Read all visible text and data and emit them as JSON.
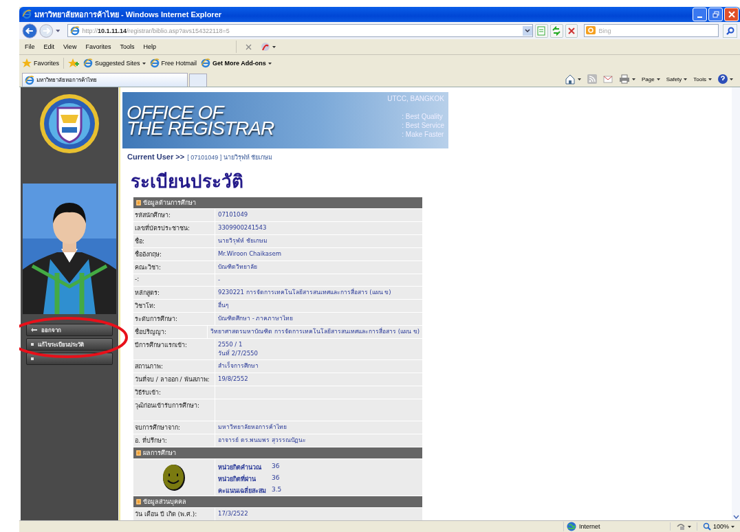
{
  "window": {
    "title": "มหาวิทยาลัยหอการค้าไทย - Windows Internet Explorer"
  },
  "address_bar": {
    "url": "http://**10.1.11.14**/registrar/biblio.asp?avs154322118=5"
  },
  "search": {
    "placeholder": "Bing"
  },
  "menu": [
    "File",
    "Edit",
    "View",
    "Favorites",
    "Tools",
    "Help"
  ],
  "favorites_bar": [
    {
      "label": "Favorites",
      "kind": "star",
      "dropdown": false,
      "bold": false
    },
    {
      "label": "Suggested Sites",
      "kind": "page",
      "dropdown": true,
      "bold": false
    },
    {
      "label": "Free Hotmail",
      "kind": "page",
      "dropdown": false,
      "bold": false
    },
    {
      "label": "Get More Add-ons",
      "kind": "page",
      "dropdown": true,
      "bold": true
    }
  ],
  "tabs": [
    {
      "title": "มหาวิทยาลัยหอการค้าไทย",
      "selected": true
    }
  ],
  "command_bar": [
    "Page",
    "Safety",
    "Tools"
  ],
  "sidebar": {
    "buttons": [
      {
        "label": "ออกจาก",
        "kind": "back"
      },
      {
        "label": "แก้ไขระเบียนประวัติ",
        "kind": "bullet"
      },
      {
        "kind": "bullet"
      }
    ]
  },
  "banner": {
    "title_line_1": "OFFICE OF",
    "title_line_2": "THE REGISTRAR",
    "location": "UTCC, BANGKOK",
    "mottos": [
      ": Best Quality",
      ": Best Service",
      ": Make Faster"
    ]
  },
  "current_user": {
    "label": "Current User >>",
    "value": "[ 07101049 ] นายวิรุฬห์ ชัยเกษม"
  },
  "heading": "ระเบียนประวัติ",
  "sections": [
    {
      "title": "ข้อมูลด้านการศึกษา",
      "kind": "fields",
      "rows": [
        {
          "label": "รหัสนักศึกษา:",
          "values": [
            "07101049"
          ]
        },
        {
          "label": "เลขที่บัตรประชาชน:",
          "values": [
            "3309900241543"
          ]
        },
        {
          "label": "ชื่อ:",
          "values": [
            "นายวิรุฬห์ ชัยเกษม"
          ]
        },
        {
          "label": "ชื่ออังกฤษ:",
          "values": [
            "Mr.Wiroon Chaikasem"
          ]
        },
        {
          "label": "คณะวิชา:",
          "values": [
            "บัณฑิตวิทยาลัย"
          ]
        },
        {
          "label": "-:",
          "values": [
            "-"
          ]
        },
        {
          "label": "หลักสูตร:",
          "values": [
            "9230221 การจัดการเทคโนโลยีสารสนเทศและการสื่อสาร (แผน ข)"
          ]
        },
        {
          "label": "วิชาโท:",
          "values": [
            "อื่นๆ"
          ]
        },
        {
          "label": "ระดับการศึกษา:",
          "values": [
            "บัณฑิตศึกษา - ภาคภาษาไทย"
          ]
        },
        {
          "label": "ชื่อปริญญา:",
          "values": [
            "วิทยาศาสตรมหาบัณฑิต การจัดการเทคโนโลยีสารสนเทศและการสื่อสาร (แผน ข)"
          ]
        },
        {
          "label": "ปีการศึกษาแรกเข้า:",
          "values": [
            "2550 / 1",
            "วันที่ 2/7/2550"
          ]
        },
        {
          "label": "สถานภาพ:",
          "values": [
            "สำเร็จการศึกษา"
          ]
        },
        {
          "label": "วันที่จบ / ลาออก / พ้นสภาพ:",
          "values": [
            "19/8/2552"
          ]
        },
        {
          "label": "วิธีรับเข้า:"
        },
        {
          "label": "วุฒิก่อนเข้ารับการศึกษา:",
          "tall": true
        },
        {
          "label": "จบการศึกษาจาก:",
          "values": [
            "มหาวิทยาลัยหอการค้าไทย"
          ]
        },
        {
          "label": "อ. ที่ปรึกษา:",
          "values": [
            "อาจารย์ ดร.พนมพร สุวรรณปัฏนะ"
          ]
        }
      ]
    },
    {
      "title": "ผลการศึกษา",
      "kind": "grades",
      "stats": [
        {
          "label": "หน่วยกิตคำนวณ",
          "value": "36"
        },
        {
          "label": "หน่วยกิตที่ผ่าน",
          "value": "36"
        },
        {
          "label": "คะแนนเฉลี่ยสะสม",
          "value": "3.5"
        }
      ]
    },
    {
      "title": "ข้อมูลส่วนบุคคล",
      "kind": "fields",
      "rows": [
        {
          "label": "วัน เดือน ปี เกิด (พ.ศ.):",
          "values": [
            "17/3/2522"
          ]
        }
      ]
    }
  ],
  "status_bar": {
    "zone": "Internet",
    "zoom": "100%"
  }
}
